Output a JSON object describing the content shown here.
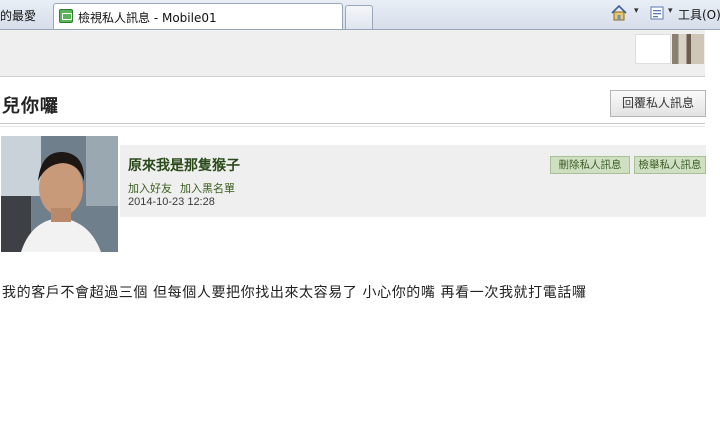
{
  "browser": {
    "favorites_label": "的最愛",
    "active_tab_title": "檢視私人訊息 - Mobile01",
    "tools_menu": "工具(O)"
  },
  "page": {
    "title": "兒你囉",
    "reply_button": "回覆私人訊息"
  },
  "message": {
    "sender_name": "原來我是那隻猴子",
    "add_friend": "加入好友",
    "add_blacklist": "加入黑名單",
    "date": "2014-10-23 12:28",
    "delete_button": "刪除私人訊息",
    "report_button": "檢舉私人訊息",
    "body": "我的客戶不會超過三個 但每個人要把你找出來太容易了 小心你的嘴 再看一次我就打電話囉"
  },
  "colors": {
    "action_button_bg": "#cfe0c2",
    "link_green": "#385d1c"
  }
}
